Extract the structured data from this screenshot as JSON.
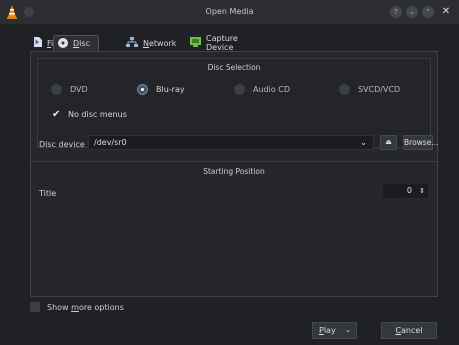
{
  "window": {
    "title": "Open Media",
    "controls": {
      "help": "?",
      "minimize": "⌄",
      "maximize": "⌃",
      "close": "✕"
    }
  },
  "tabs": [
    {
      "label": "File",
      "accel": "F",
      "rest": "ile",
      "icon": "file-icon"
    },
    {
      "label": "Disc",
      "accel": "D",
      "rest": "isc",
      "icon": "disc-icon",
      "active": true
    },
    {
      "label": "Network",
      "accel": "N",
      "rest": "etwork",
      "icon": "network-icon"
    },
    {
      "label": "Capture Device",
      "prefix": "Capture ",
      "accel": "D",
      "rest": "evice",
      "icon": "capture-device-icon"
    }
  ],
  "disc_selection": {
    "title": "Disc Selection",
    "options": [
      {
        "label": "DVD",
        "checked": false
      },
      {
        "label": "Blu-ray",
        "checked": true
      },
      {
        "label": "Audio CD",
        "checked": false
      },
      {
        "label": "SVCD/VCD",
        "checked": false
      }
    ],
    "no_disc_menus": {
      "label": "No disc menus",
      "checked": true
    }
  },
  "disc_device": {
    "label": "Disc device",
    "value": "/dev/sr0",
    "browse_label": "Browse..."
  },
  "starting_position": {
    "title": "Starting Position",
    "title_label": "Title",
    "title_value": "0"
  },
  "footer": {
    "show_more_prefix": "Show ",
    "show_more_accel": "m",
    "show_more_rest": "ore options",
    "play_accel": "P",
    "play_rest": "lay",
    "cancel_accel": "C",
    "cancel_rest": "ancel"
  },
  "colors": {
    "background": "#1f2124",
    "titlebar": "#2c2e32",
    "accent": "#6a88b0",
    "text": "#d6d6d6"
  }
}
